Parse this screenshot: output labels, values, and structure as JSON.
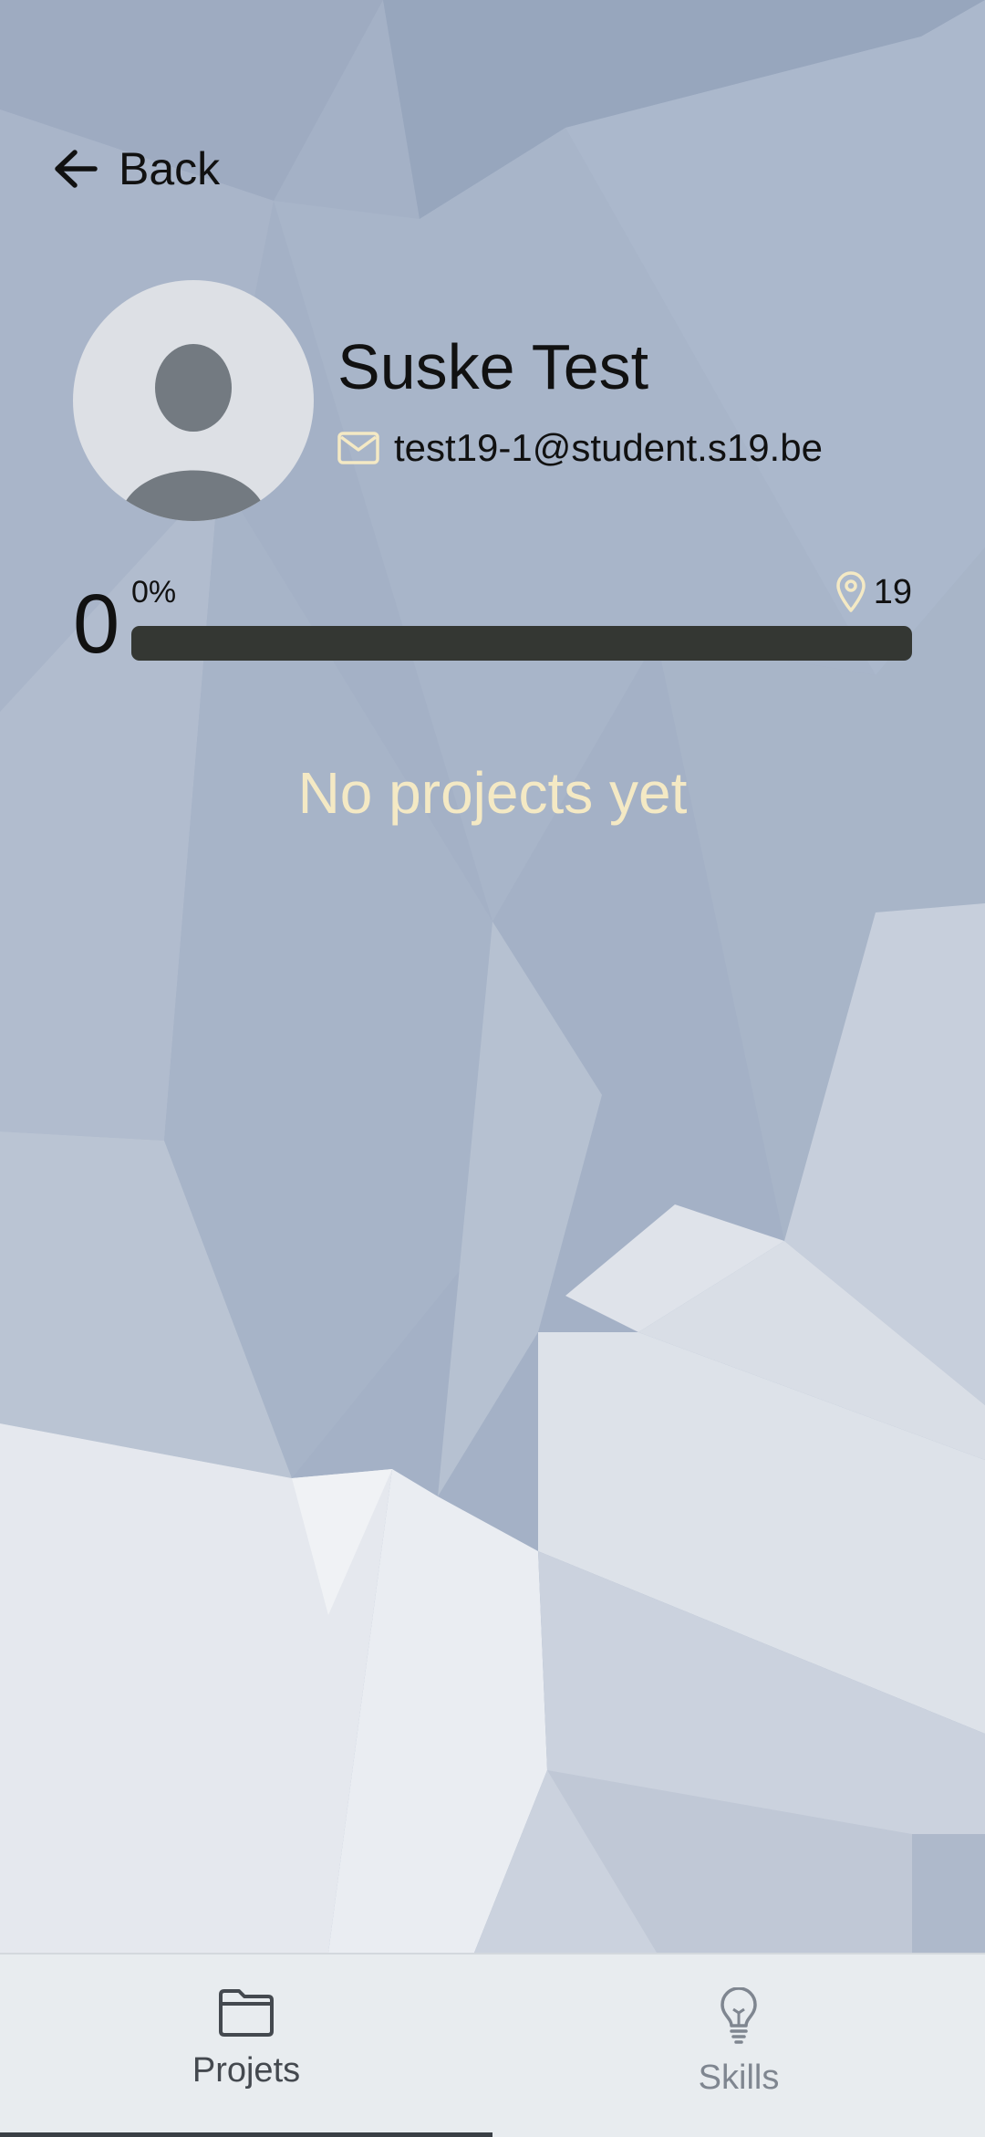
{
  "colors": {
    "background": "#a6b3c8",
    "accent_cream": "#f4e9c4",
    "progress_track": "#343733",
    "tabbar": "#e8ecef"
  },
  "header": {
    "back_label": "Back",
    "back_icon": "arrow-left-icon"
  },
  "profile": {
    "avatar_icon": "user-placeholder-icon",
    "name": "Suske Test",
    "email_icon": "envelope-icon",
    "email": "test19-1@student.s19.be"
  },
  "progress": {
    "level": "0",
    "percent_label": "0%",
    "percent_value": 0,
    "campus_icon": "map-pin-icon",
    "campus": "19"
  },
  "main": {
    "empty_message": "No projects yet"
  },
  "tabs": [
    {
      "label": "Projets",
      "icon": "folder-icon",
      "active": true
    },
    {
      "label": "Skills",
      "icon": "lightbulb-icon",
      "active": false
    }
  ]
}
